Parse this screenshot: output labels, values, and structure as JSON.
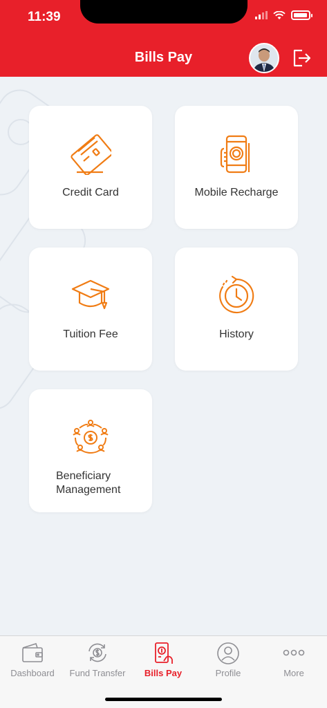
{
  "status_bar": {
    "time": "11:39"
  },
  "header": {
    "title": "Bills Pay"
  },
  "tiles": [
    {
      "label": "Credit Card",
      "icon": "credit-card-icon"
    },
    {
      "label": "Mobile Recharge",
      "icon": "mobile-recharge-icon"
    },
    {
      "label": "Tuition Fee",
      "icon": "graduation-cap-icon"
    },
    {
      "label": "History",
      "icon": "history-clock-icon"
    },
    {
      "label_line1": "Beneficiary",
      "label_line2": "Management",
      "icon": "beneficiary-network-icon"
    }
  ],
  "tabbar": {
    "items": [
      {
        "label": "Dashboard",
        "icon": "wallet-icon",
        "active": false
      },
      {
        "label": "Fund Transfer",
        "icon": "fund-transfer-icon",
        "active": false
      },
      {
        "label": "Bills Pay",
        "icon": "bills-pay-icon",
        "active": true
      },
      {
        "label": "Profile",
        "icon": "profile-icon",
        "active": false
      },
      {
        "label": "More",
        "icon": "more-icon",
        "active": false
      }
    ]
  },
  "colors": {
    "brand_red": "#e8202a",
    "icon_orange": "#f07c14",
    "background": "#eef2f6"
  }
}
